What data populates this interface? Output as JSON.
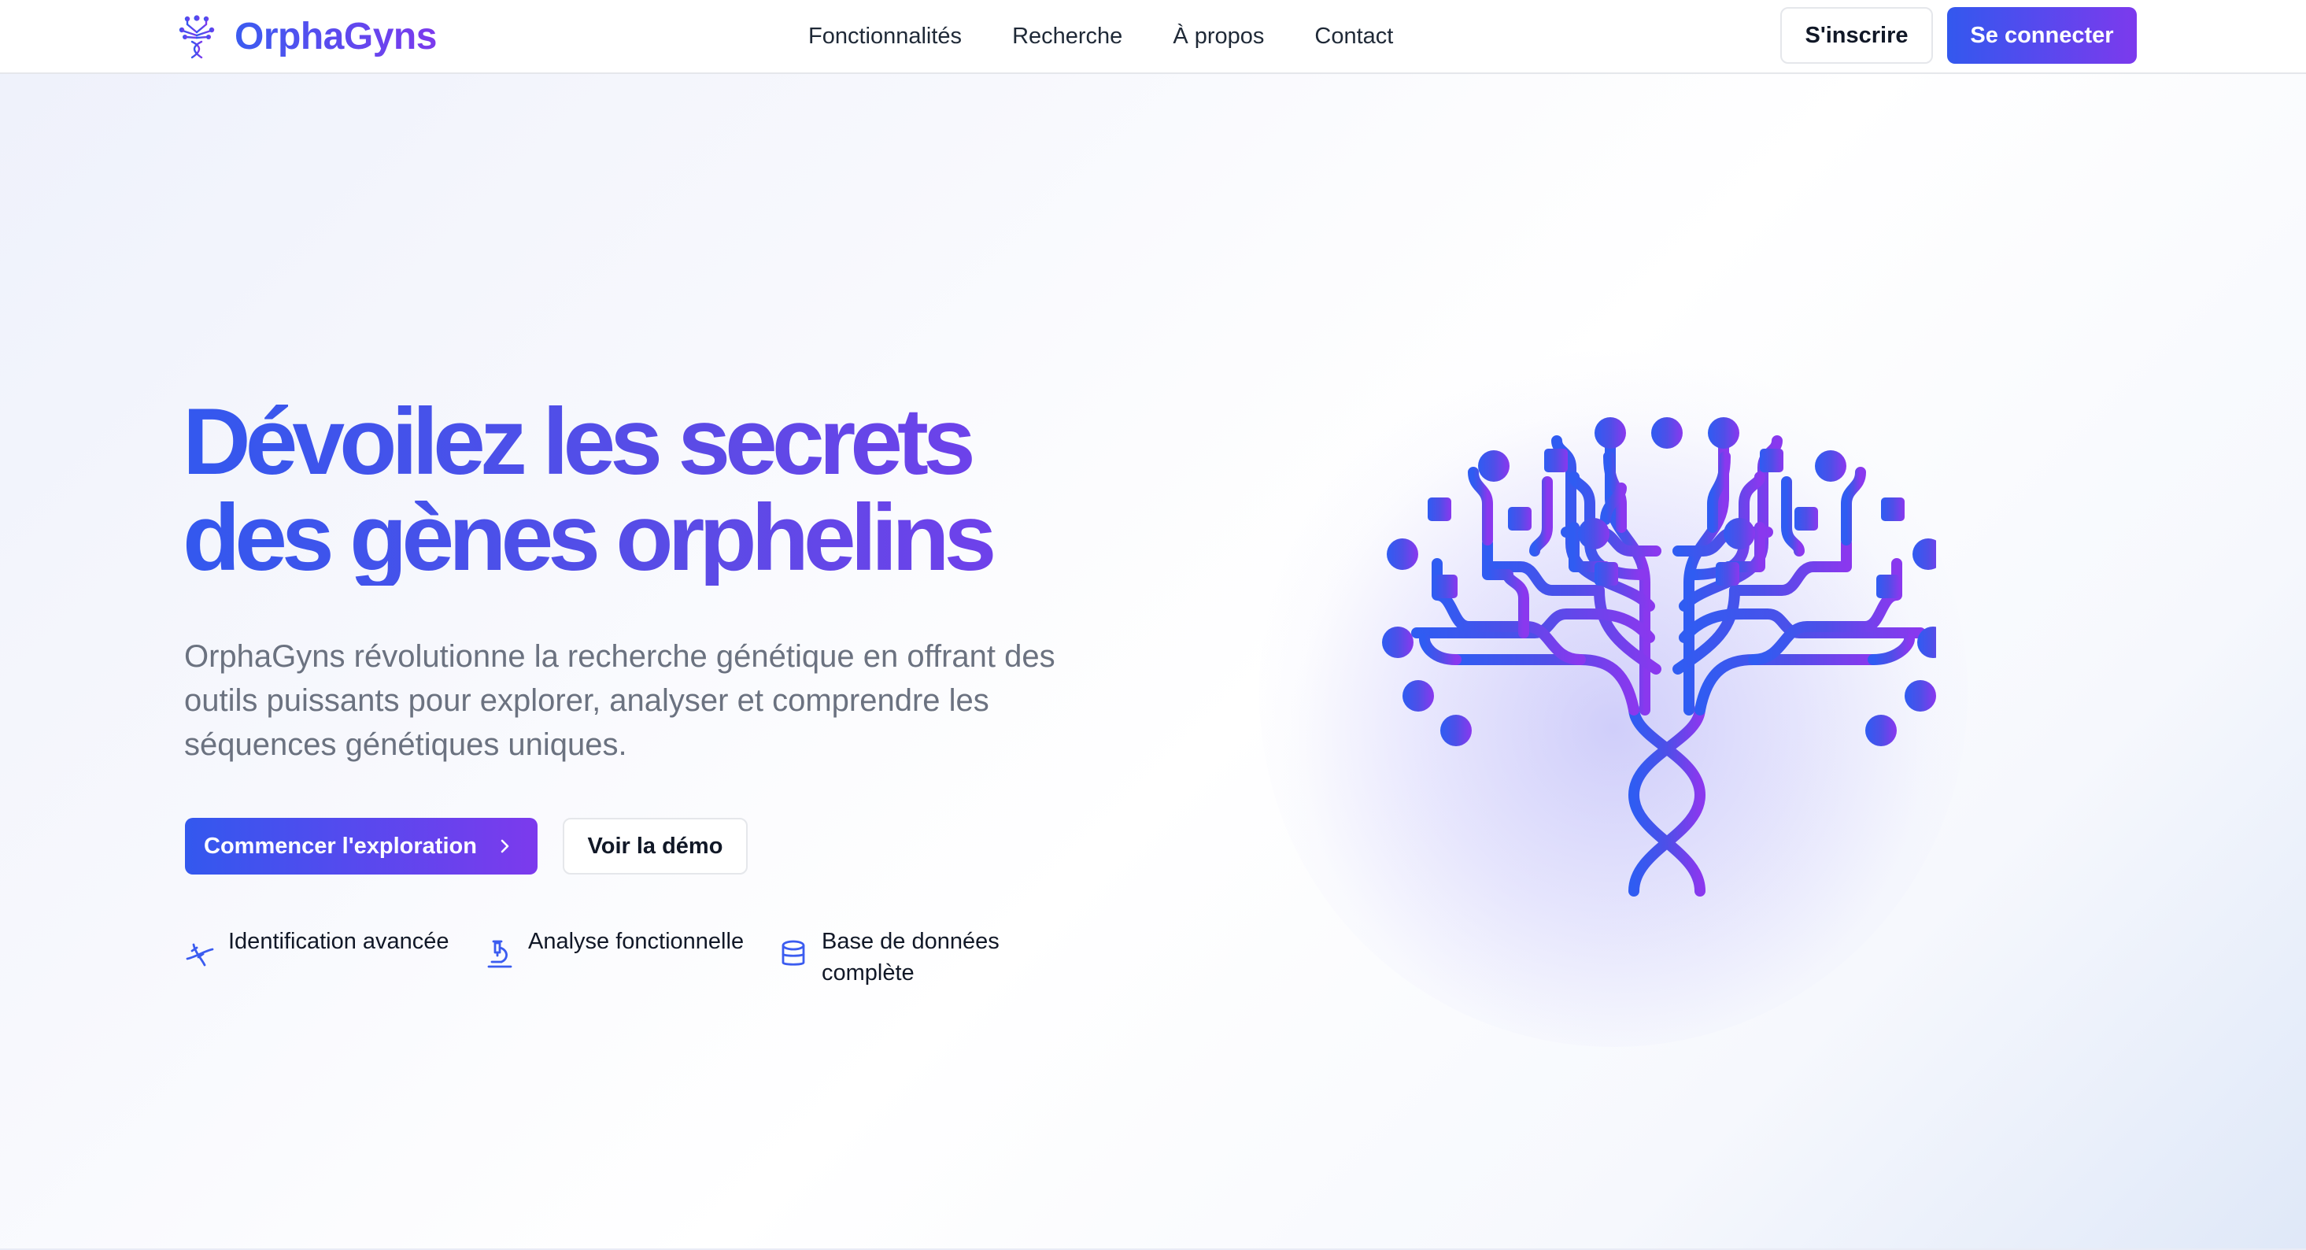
{
  "brand": {
    "name": "OrphaGyns",
    "logo_icon": "tree-dna-icon"
  },
  "nav": {
    "items": [
      {
        "label": "Fonctionnalités"
      },
      {
        "label": "Recherche"
      },
      {
        "label": "À propos"
      },
      {
        "label": "Contact"
      }
    ]
  },
  "auth": {
    "signup_label": "S'inscrire",
    "login_label": "Se connecter"
  },
  "hero": {
    "title_line1": "Dévoilez les secrets",
    "title_line2": "des gènes orphelins",
    "subtitle": "OrphaGyns révolutionne la recherche génétique en offrant des outils puissants pour explorer, analyser et comprendre les séquences génétiques uniques.",
    "primary_cta": "Commencer l'exploration",
    "secondary_cta": "Voir la démo"
  },
  "features": [
    {
      "icon": "dna-icon",
      "label": "Identification avancée"
    },
    {
      "icon": "microscope-icon",
      "label": "Analyse fonctionnelle"
    },
    {
      "icon": "database-icon",
      "label": "Base de données complète"
    }
  ],
  "illustration": {
    "icon": "dna-tree-illustration"
  },
  "colors": {
    "accent_start": "#3358ee",
    "accent_end": "#7c3aed",
    "text_muted": "#6b7280"
  }
}
